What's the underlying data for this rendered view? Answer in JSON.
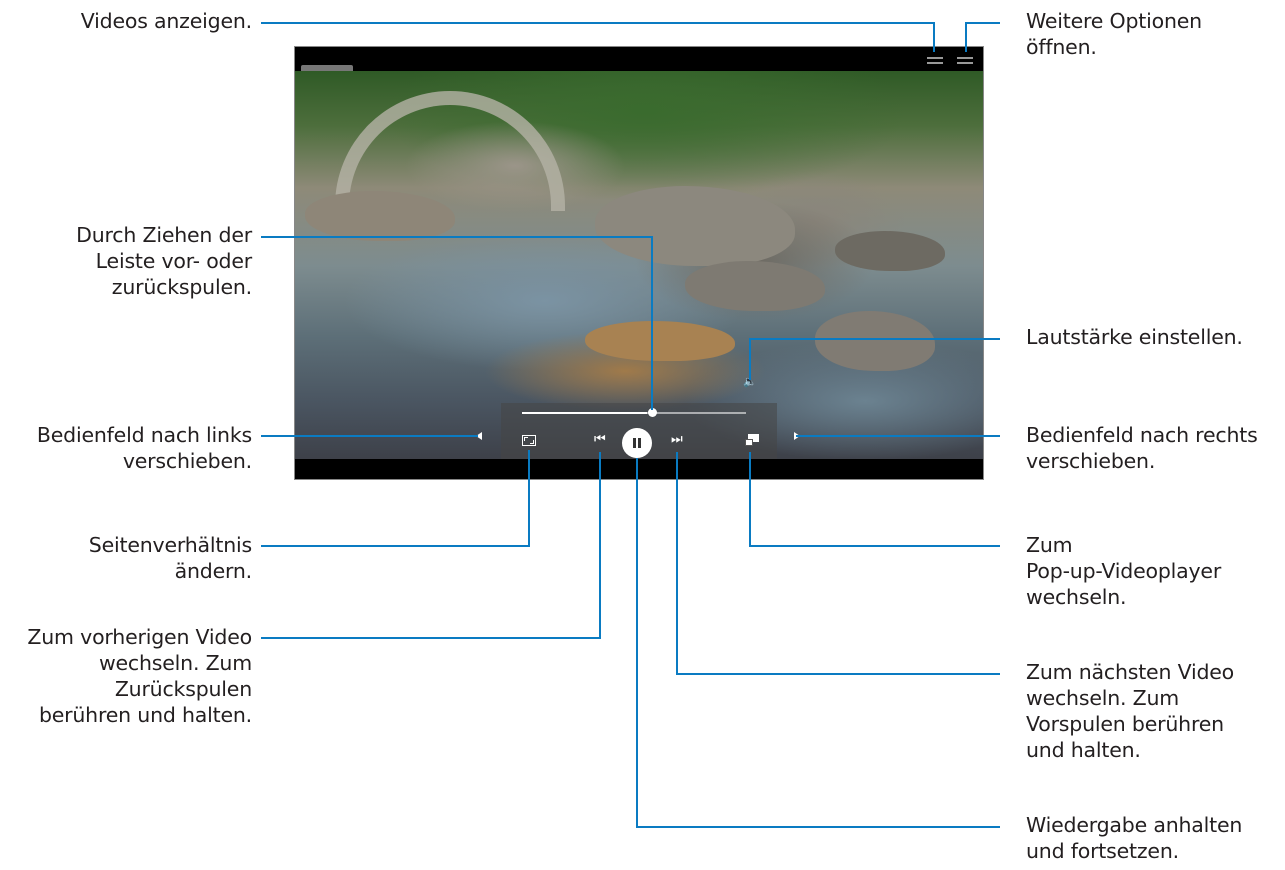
{
  "labels": {
    "videos": "Videos anzeigen.",
    "options": "Weitere Optionen\nöffnen.",
    "seek": "Durch Ziehen der\nLeiste vor- oder\nzurückspulen.",
    "volume": "Lautstärke einstellen.",
    "panel_left": "Bedienfeld nach links\nverschieben.",
    "panel_right": "Bedienfeld nach rechts\nverschieben.",
    "aspect": "Seitenverhältnis\nändern.",
    "popup": "Zum\nPop-up-Videoplayer\nwechseln.",
    "prev": "Zum vorherigen Video\nwechseln. Zum\nZurückspulen\nberühren und halten.",
    "next": "Zum nächsten Video\nwechseln. Zum\nVorspulen berühren\nund halten.",
    "pause": "Wiedergabe anhalten\nund fortsetzen."
  },
  "player": {
    "progress": 0.56
  },
  "icons": {
    "prev": "⏮",
    "next": "⏭",
    "volume": "🔈"
  },
  "colors": {
    "leader": "#0a7bc2",
    "text": "#231f20"
  }
}
